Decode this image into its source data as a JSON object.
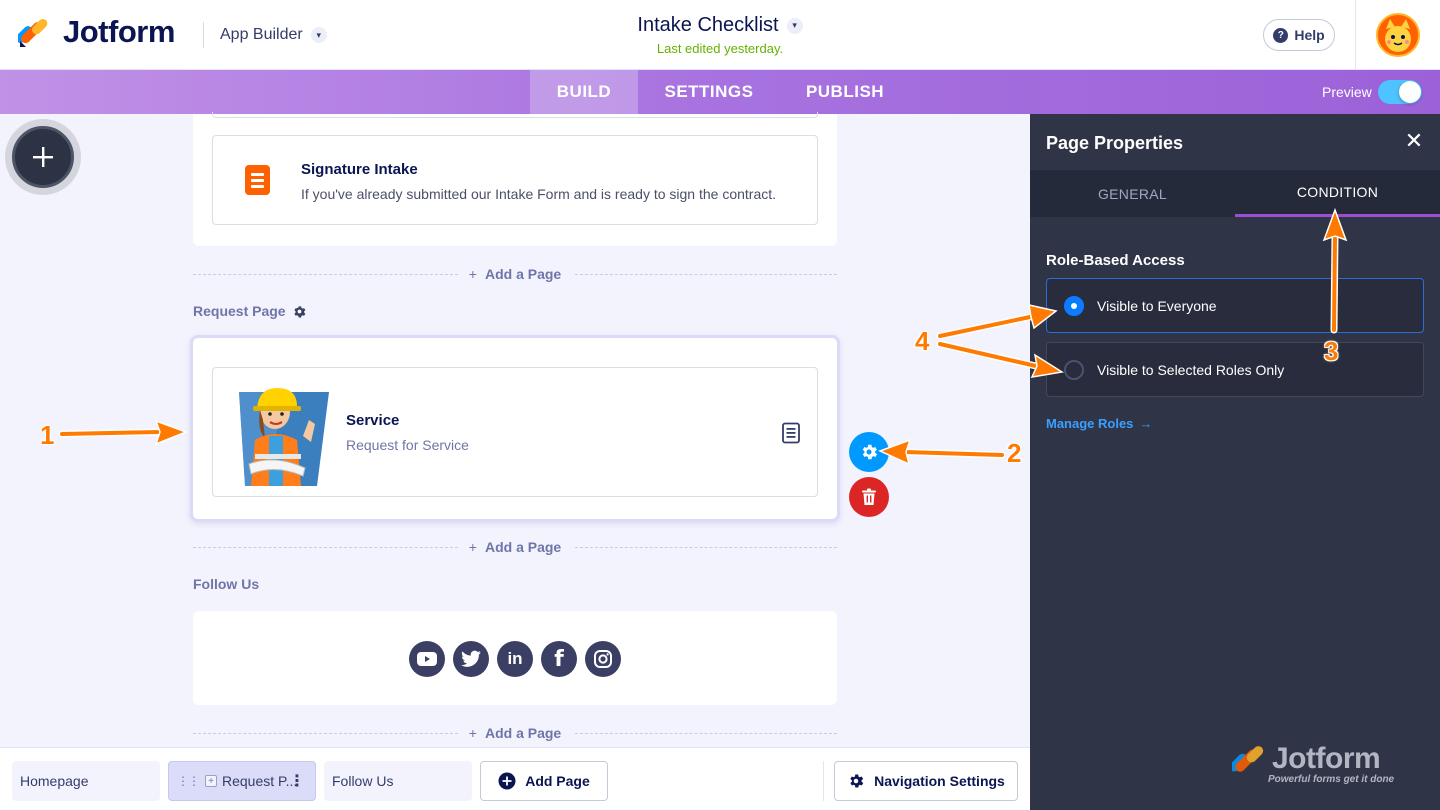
{
  "header": {
    "brand": "Jotform",
    "app_builder": "App Builder",
    "title": "Intake Checklist",
    "subtitle": "Last edited yesterday.",
    "help": "Help"
  },
  "nav": {
    "tabs": [
      "BUILD",
      "SETTINGS",
      "PUBLISH"
    ],
    "active_tab": "BUILD",
    "preview_label": "Preview",
    "preview_on": true
  },
  "canvas": {
    "signature_item": {
      "title": "Signature Intake",
      "description": "If you've already submitted our Intake Form and is ready to sign the contract."
    },
    "add_page_label": "Add a Page",
    "request_section": "Request Page",
    "service_item": {
      "title": "Service",
      "description": "Request for Service"
    },
    "follow_section": "Follow Us",
    "social_icons": [
      "youtube-icon",
      "twitter-icon",
      "linkedin-icon",
      "facebook-icon",
      "instagram-icon"
    ]
  },
  "bottom_bar": {
    "pages": [
      "Homepage",
      "Request P...",
      "Follow Us"
    ],
    "active_page": "Request P...",
    "add_page": "Add Page",
    "nav_settings": "Navigation Settings"
  },
  "panel": {
    "title": "Page Properties",
    "tabs": [
      "GENERAL",
      "CONDITION"
    ],
    "active_tab": "CONDITION",
    "section_label": "Role-Based Access",
    "options": [
      "Visible to Everyone",
      "Visible to Selected Roles Only"
    ],
    "selected_option": "Visible to Everyone",
    "manage_roles": "Manage Roles",
    "watermark": "Jotform",
    "watermark_tagline": "Powerful forms get it done"
  },
  "annotations": [
    "1",
    "2",
    "3",
    "4"
  ],
  "colors": {
    "brand_navy": "#0a1551",
    "nav_purple": "#a772e0",
    "accent_blue": "#0099ff",
    "danger_red": "#dc2626",
    "annotation_orange": "#ff7a00",
    "panel_bg": "#2f3447"
  }
}
